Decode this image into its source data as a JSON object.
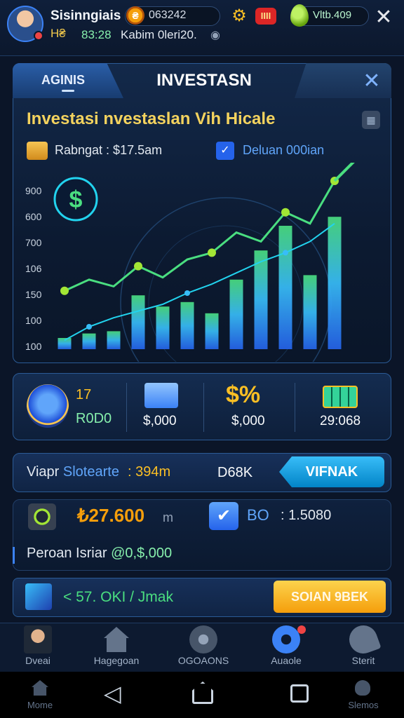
{
  "header": {
    "player_name": "Sisinngiais",
    "coin_icon": "coin-icon",
    "coin_value": "063242",
    "settings_icon": "gear-icon",
    "mail_label": "IIII",
    "gem_value": "Vltb.409",
    "close_icon": "close-icon",
    "sub_icons": "H₴",
    "sub_stat": "83:28",
    "sub_status": "Kabim 0leri20.",
    "sub_eye": "eye-icon"
  },
  "panel": {
    "tab_left": "AGINIS",
    "tab_main": "INVESTASN",
    "close_icon": "close-icon",
    "title": "Investasi nvestaslan Vih Hicale",
    "corner_icon": "chart-icon",
    "budget_label": "Rabngat : $17.5am",
    "budget_value2": "Deluan 000ian"
  },
  "chart_data": {
    "type": "bar",
    "title": "",
    "xlabel": "",
    "ylabel": "",
    "y_ticks": [
      "900",
      "600",
      "700",
      "106",
      "150",
      "100",
      "100"
    ],
    "bars": [
      10,
      14,
      16,
      48,
      38,
      42,
      32,
      62,
      88,
      110,
      66,
      118
    ],
    "line": [
      52,
      62,
      56,
      74,
      64,
      80,
      86,
      104,
      96,
      122,
      112,
      150
    ],
    "trend": [
      8,
      20,
      28,
      34,
      40,
      50,
      58,
      68,
      78,
      86,
      96,
      112
    ]
  },
  "stats": {
    "shield_top": "17",
    "shield_bottom": "R0D0",
    "envelope_value": "$,000",
    "dollar_glyph": "$%",
    "dollar_value": "$,000",
    "grid_value": "29:068"
  },
  "action": {
    "label_prefix": "Viapr ",
    "label_highlight": "Slotearte",
    "amount": ": 394m",
    "code": "D68K",
    "button": "VIFNAK"
  },
  "info": {
    "coin_value": "₺27.600",
    "coin_unit": "m",
    "check_code": "BO",
    "value": ": 1.5080",
    "line_prefix": "Peroan Isriar ",
    "line_highlight": "@0,$,000"
  },
  "bottom": {
    "text": "< 57. OKI / Jmak",
    "button": "SOIAN 9BEK"
  },
  "nav": {
    "items": [
      {
        "label": "Dveai",
        "icon": "avatar-icon"
      },
      {
        "label": "Hagegoan",
        "icon": "home-icon"
      },
      {
        "label": "OGOAONS",
        "icon": "compass-icon"
      },
      {
        "label": "Auaole",
        "icon": "gear-icon"
      },
      {
        "label": "Sterit",
        "icon": "brush-icon"
      }
    ]
  },
  "system": {
    "left_label": "Mome",
    "right_label": "Slemos"
  }
}
